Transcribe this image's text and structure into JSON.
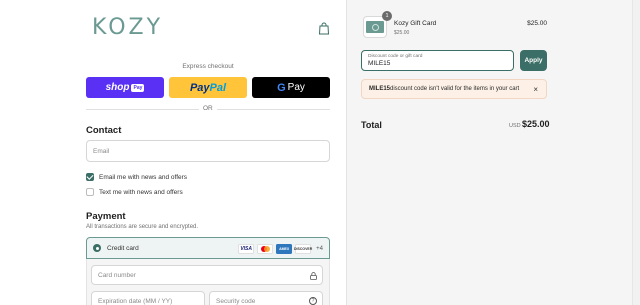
{
  "brand": {
    "logo_text": "KOZY"
  },
  "express": {
    "title": "Express checkout",
    "shop_label": "shop",
    "shop_tag": "Pay",
    "paypal_part1": "Pay",
    "paypal_part2": "Pal",
    "gpay_g": "G",
    "gpay_label": "Pay",
    "or_text": "OR"
  },
  "contact": {
    "title": "Contact",
    "email_placeholder": "Email",
    "news_label": "Email me with news and offers",
    "news_checked": true,
    "text_label": "Text me with news and offers",
    "text_checked": false
  },
  "payment": {
    "title": "Payment",
    "subtitle": "All transactions are secure and encrypted.",
    "method_label": "Credit card",
    "cards": [
      "VISA",
      "MC",
      "AMEX",
      "DISCOVER"
    ],
    "more_cards": "+4",
    "card_number_placeholder": "Card number",
    "expiry_placeholder": "Expiration date (MM / YY)",
    "security_placeholder": "Security code",
    "help_glyph": "?"
  },
  "summary": {
    "item": {
      "name": "Kozy Gift Card",
      "variant": "$25.00",
      "price": "$25.00",
      "quantity": "1"
    },
    "discount": {
      "placeholder": "Discount code or gift card",
      "value": "MILE15",
      "apply_label": "Apply"
    },
    "error": {
      "code": "MILE15",
      "message": " discount code isn't valid for the items in your cart",
      "close_glyph": "×"
    },
    "total": {
      "label": "Total",
      "currency": "USD",
      "value": "$25.00"
    }
  },
  "colors": {
    "accent": "#3b6e66",
    "shop_pay": "#5a31f4",
    "paypal": "#ffc439",
    "gpay": "#000000",
    "error_bg": "#fdf0e6"
  }
}
